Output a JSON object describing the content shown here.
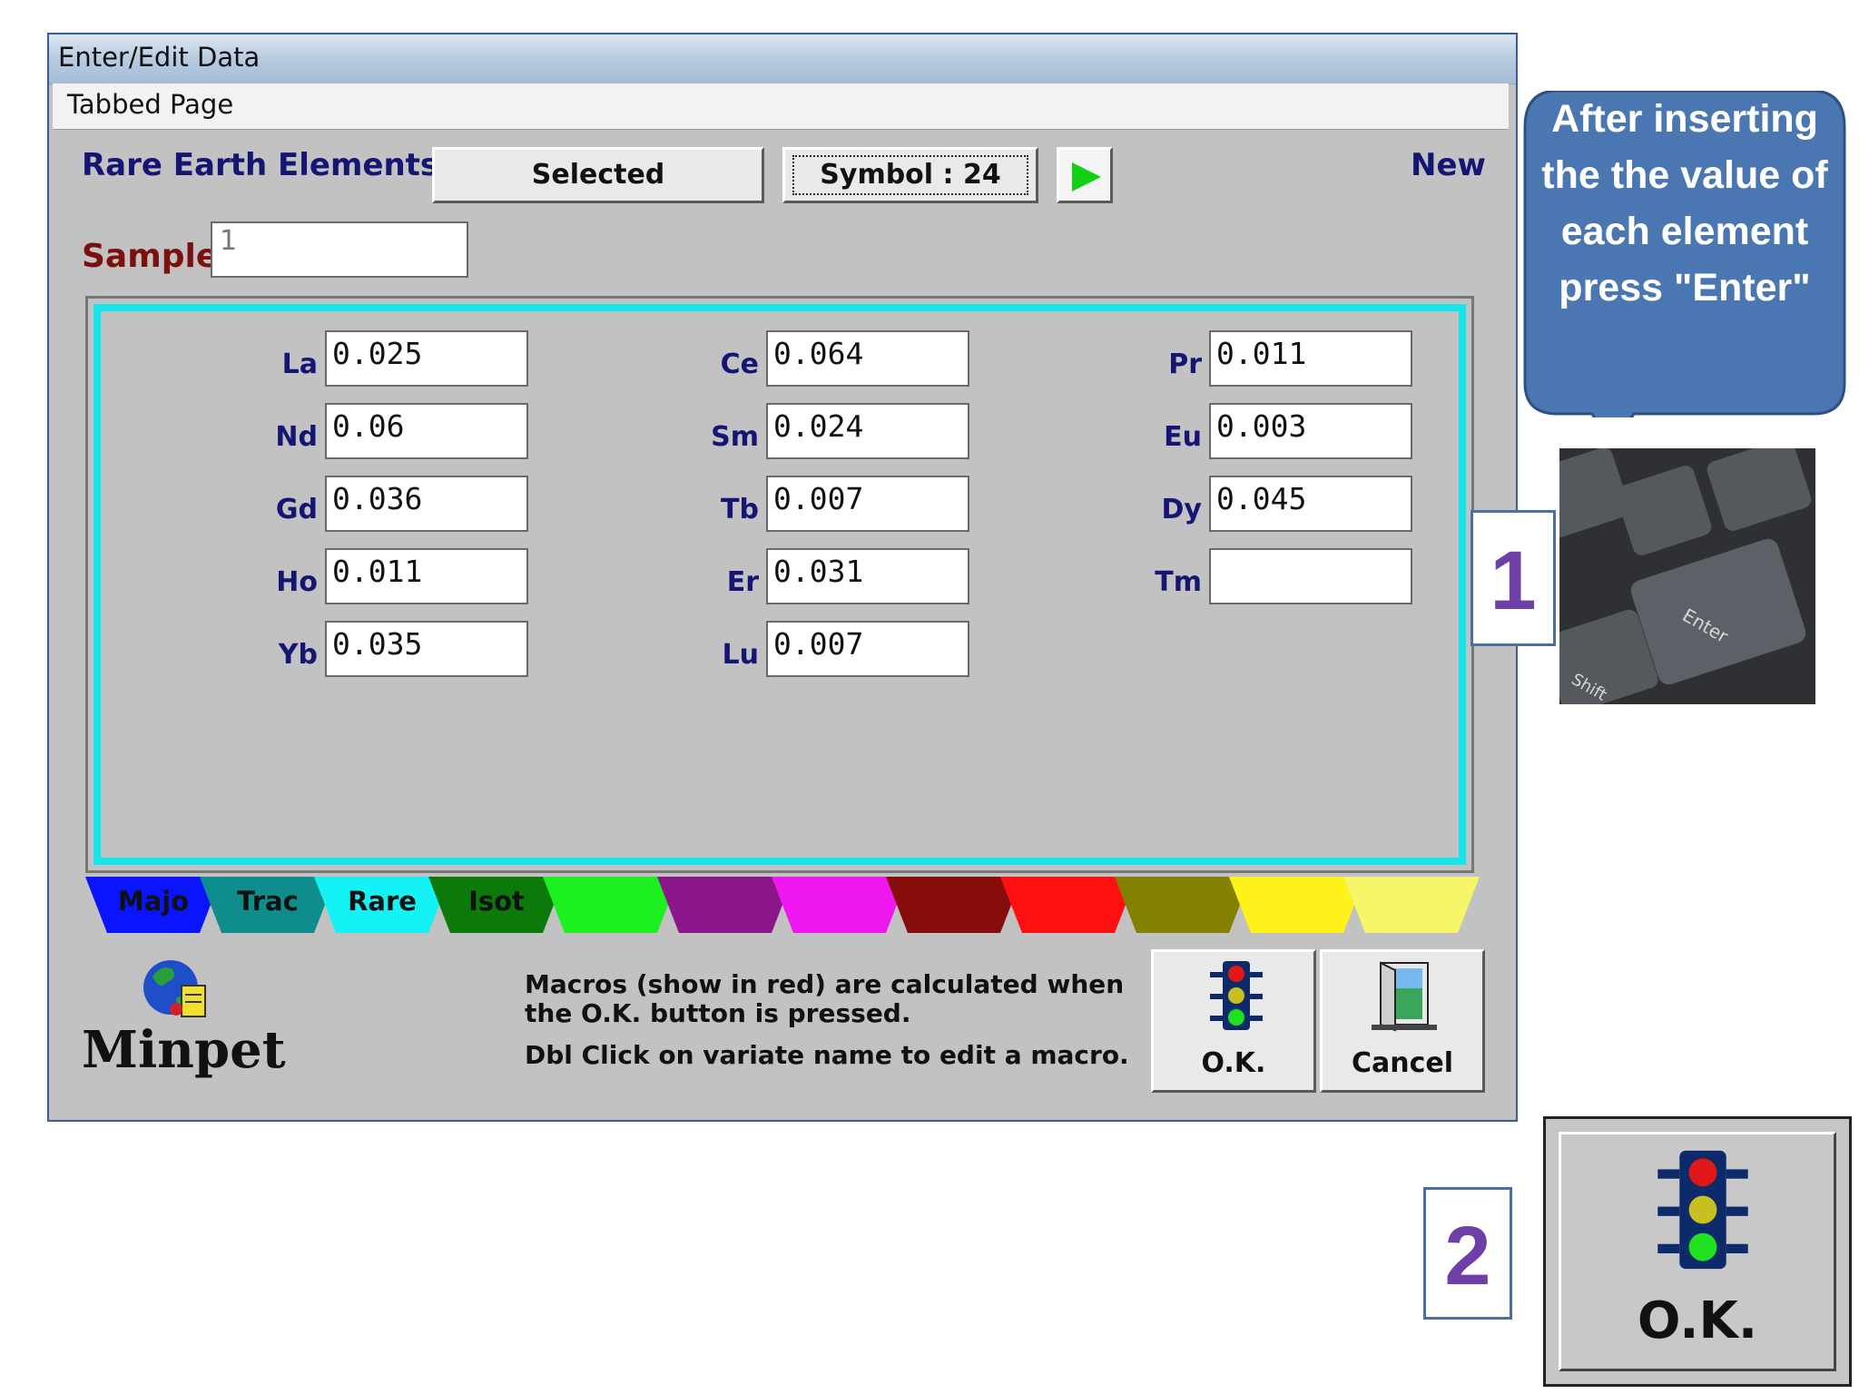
{
  "window": {
    "title": "Enter/Edit Data",
    "menu": {
      "tabbed_page": "Tabbed Page"
    },
    "group_label": "Rare Earth Elements",
    "selected_label": "Selected",
    "symbol_label": "Symbol : 24",
    "new_label": "New",
    "sample": {
      "label": "Sample",
      "value": "1"
    },
    "elements": [
      {
        "symbol": "La",
        "value": "0.025"
      },
      {
        "symbol": "Ce",
        "value": "0.064"
      },
      {
        "symbol": "Pr",
        "value": "0.011"
      },
      {
        "symbol": "Nd",
        "value": "0.06"
      },
      {
        "symbol": "Sm",
        "value": "0.024"
      },
      {
        "symbol": "Eu",
        "value": "0.003"
      },
      {
        "symbol": "Gd",
        "value": "0.036"
      },
      {
        "symbol": "Tb",
        "value": "0.007"
      },
      {
        "symbol": "Dy",
        "value": "0.045"
      },
      {
        "symbol": "Ho",
        "value": "0.011"
      },
      {
        "symbol": "Er",
        "value": "0.031"
      },
      {
        "symbol": "Tm",
        "value": ""
      },
      {
        "symbol": "Yb",
        "value": "0.035"
      },
      {
        "symbol": "Lu",
        "value": "0.007"
      }
    ],
    "tabs": [
      {
        "label": "Majo",
        "color": "#0a14ff"
      },
      {
        "label": "Trac",
        "color": "#0f8c8c"
      },
      {
        "label": "Rare",
        "color": "#14f2f6"
      },
      {
        "label": "Isot",
        "color": "#0b7a0b"
      },
      {
        "label": "",
        "color": "#1cf020"
      },
      {
        "label": "",
        "color": "#8a168a"
      },
      {
        "label": "",
        "color": "#f018f0"
      },
      {
        "label": "",
        "color": "#870c0c"
      },
      {
        "label": "",
        "color": "#ff1010"
      },
      {
        "label": "",
        "color": "#848000"
      },
      {
        "label": "",
        "color": "#fff21a"
      },
      {
        "label": "",
        "color": "#f7f56a"
      }
    ],
    "brand": "Minpet",
    "notes": {
      "line1": "Macros (show in red) are calculated when",
      "line2": "the O.K. button is pressed.",
      "line3": "Dbl Click on variate name to edit a macro."
    },
    "ok_label": "O.K.",
    "cancel_label": "Cancel"
  },
  "annotation": {
    "callout_text": "After inserting the the value of each element press \"Enter\"",
    "step1": "1",
    "step2": "2",
    "zoom_ok_label": "O.K.",
    "keyboard_keys": [
      "Enter",
      "Shift"
    ],
    "callout_color": "#4a76b2"
  }
}
